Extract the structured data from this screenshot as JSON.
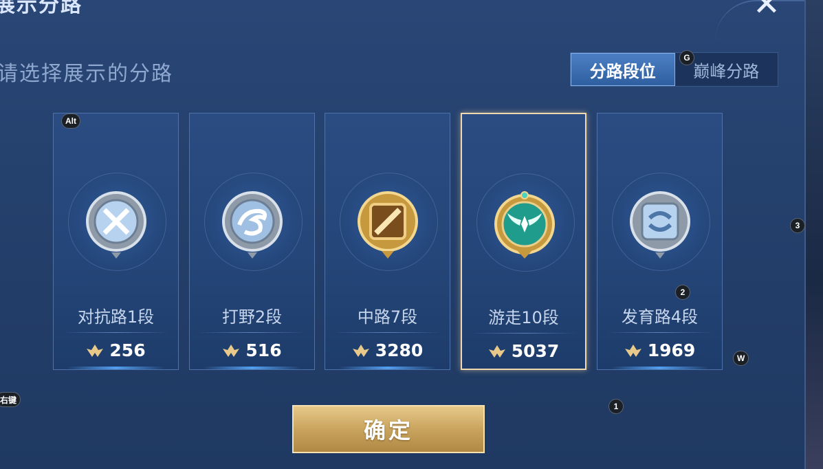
{
  "header": {
    "title": "展示分路",
    "close_glyph": "✕"
  },
  "prompt": "请选择展示的分路",
  "tabs": [
    {
      "label": "分路段位",
      "active": true
    },
    {
      "label": "巅峰分路",
      "active": false
    }
  ],
  "cards": [
    {
      "label": "对抗路1段",
      "score": "256",
      "emblem": "crossed-swords-silver",
      "selected": false
    },
    {
      "label": "打野2段",
      "score": "516",
      "emblem": "dragon-silver",
      "selected": false
    },
    {
      "label": "中路7段",
      "score": "3280",
      "emblem": "staff-gold",
      "selected": false
    },
    {
      "label": "游走10段",
      "score": "5037",
      "emblem": "wings-jade-gold",
      "selected": true
    },
    {
      "label": "发育路4段",
      "score": "1969",
      "emblem": "arrow-silver",
      "selected": false
    }
  ],
  "confirm_label": "确定",
  "key_hints": {
    "alt": "Alt",
    "g": "G",
    "three": "3",
    "two": "2",
    "w": "W",
    "one": "1",
    "right_click": "右键"
  },
  "colors": {
    "background": "#24406c",
    "card": "#244577",
    "selected_border": "#f0d9b0",
    "gold": "#c9a45e",
    "tab_active": "#3f72b5"
  }
}
